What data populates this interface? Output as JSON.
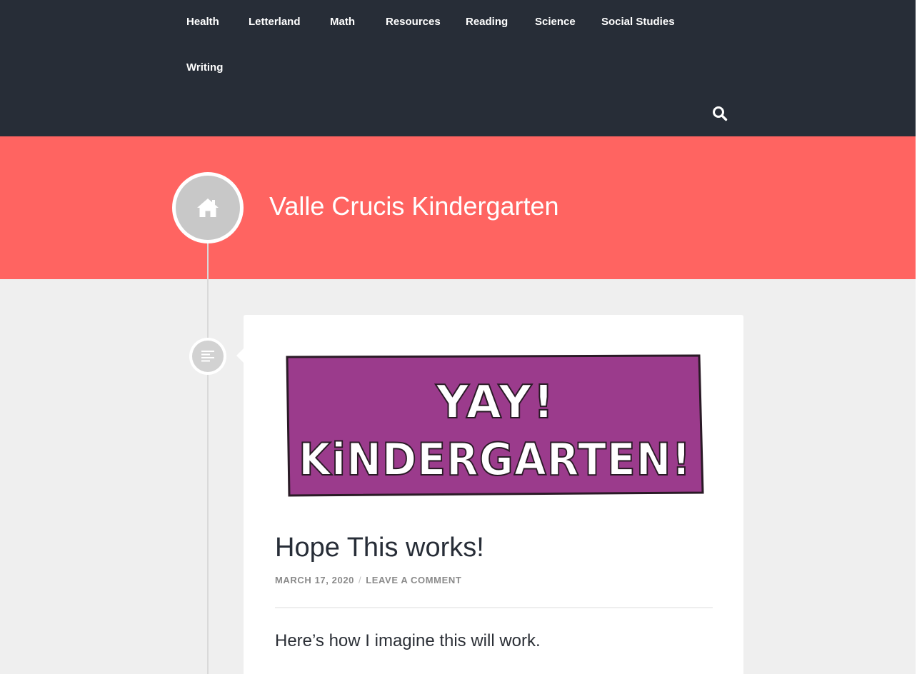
{
  "nav": {
    "items": [
      {
        "label": "Health"
      },
      {
        "label": "Letterland"
      },
      {
        "label": "Math"
      },
      {
        "label": "Resources"
      },
      {
        "label": "Reading"
      },
      {
        "label": "Science"
      },
      {
        "label": "Social Studies"
      },
      {
        "label": "Writing"
      }
    ],
    "search_icon": "search-icon"
  },
  "header": {
    "site_title": "Valle Crucis Kindergarten",
    "home_icon": "home-icon"
  },
  "post": {
    "format_icon": "text-lines-icon",
    "image_text_line1": "YAY!",
    "image_text_line2": "KiNDERGARTEN!",
    "title": "Hope This works!",
    "date": "MARCH 17, 2020",
    "meta_separator": "/",
    "comment_link": "LEAVE A COMMENT",
    "excerpt": "Here’s how I imagine this will work."
  },
  "colors": {
    "topbar": "#272d37",
    "hero": "#ff6461",
    "banner_purple": "#9b3b8c",
    "text_dark": "#272d37"
  }
}
